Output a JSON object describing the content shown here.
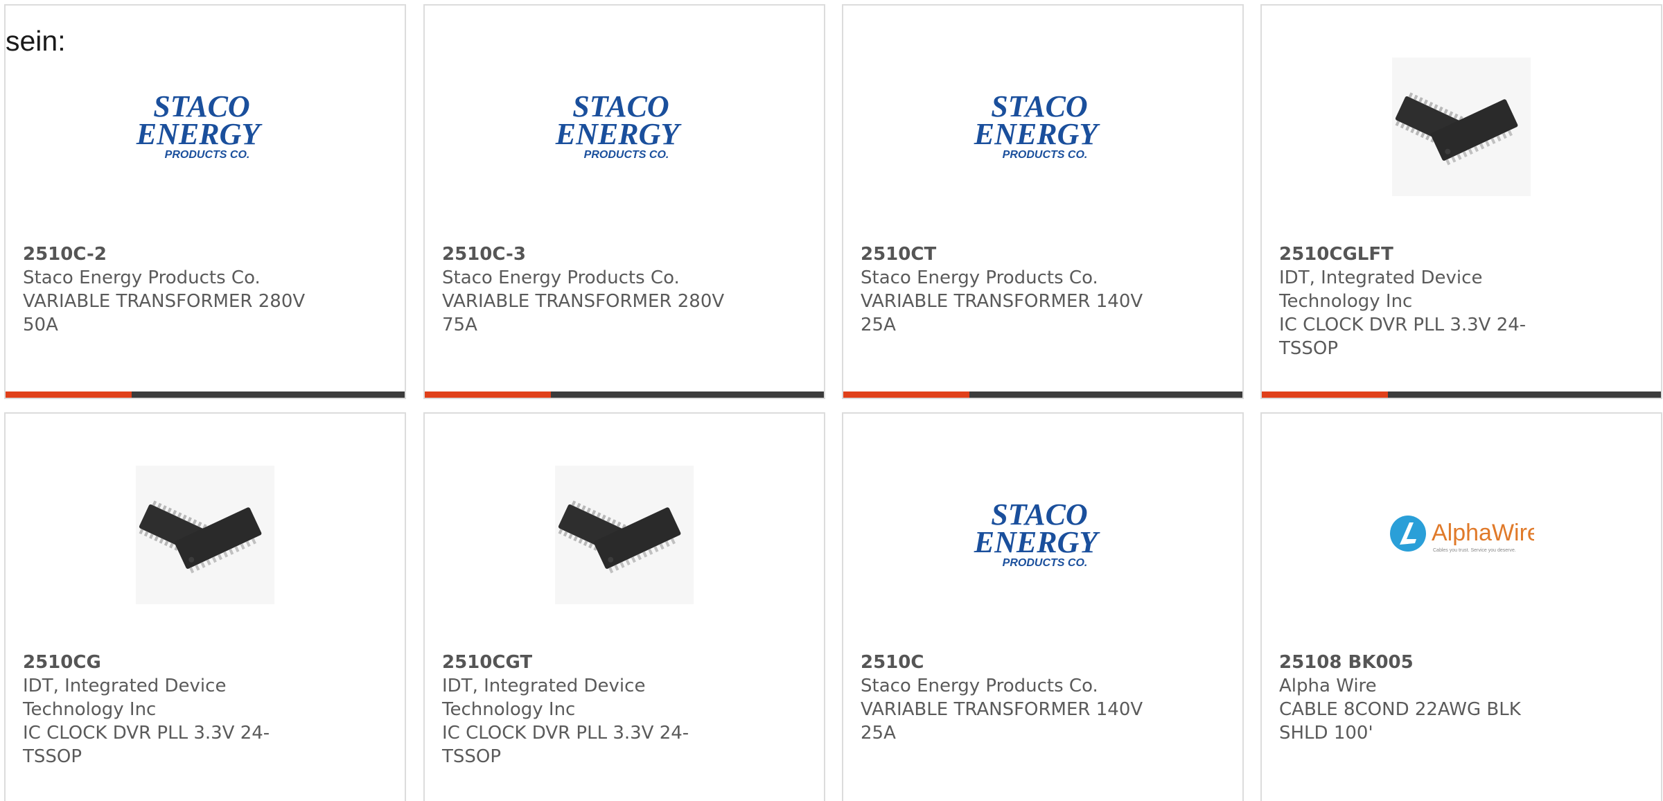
{
  "lead_text": "sein:",
  "cards": [
    {
      "part": "2510C-2",
      "maker": "Staco Energy Products Co.",
      "desc": "VARIABLE TRANSFORMER 280V 50A",
      "image": "staco-logo"
    },
    {
      "part": "2510C-3",
      "maker": "Staco Energy Products Co.",
      "desc": "VARIABLE TRANSFORMER 280V 75A",
      "image": "staco-logo"
    },
    {
      "part": "2510CT",
      "maker": "Staco Energy Products Co.",
      "desc": "VARIABLE TRANSFORMER 140V 25A",
      "image": "staco-logo"
    },
    {
      "part": "2510CGLFT",
      "maker": "IDT, Integrated Device Technology Inc",
      "desc": "IC CLOCK DVR PLL 3.3V 24-TSSOP",
      "image": "tssop-chip"
    },
    {
      "part": "2510CG",
      "maker": "IDT, Integrated Device Technology Inc",
      "desc": "IC CLOCK DVR PLL 3.3V 24-TSSOP",
      "image": "tssop-chip"
    },
    {
      "part": "2510CGT",
      "maker": "IDT, Integrated Device Technology Inc",
      "desc": "IC CLOCK DVR PLL 3.3V 24-TSSOP",
      "image": "tssop-chip"
    },
    {
      "part": "2510C",
      "maker": "Staco Energy Products Co.",
      "desc": "VARIABLE TRANSFORMER 140V 25A",
      "image": "staco-logo"
    },
    {
      "part": "25108 BK005",
      "maker": "Alpha Wire",
      "desc": "CABLE 8COND 22AWG BLK SHLD 100'",
      "image": "alphawire-logo"
    }
  ],
  "logos": {
    "staco_line1": "STACO",
    "staco_line2": "ENERGY",
    "staco_line3": "PRODUCTS CO.",
    "alpha_name": "AlphaWire",
    "alpha_tagline": "Cables you trust. Service you deserve."
  },
  "colors": {
    "accent": "#e0401a",
    "bar": "#3b3b3b",
    "staco_blue": "#1a4f9c",
    "alpha_orange": "#e07a2a",
    "alpha_blue": "#2a9fd8"
  }
}
